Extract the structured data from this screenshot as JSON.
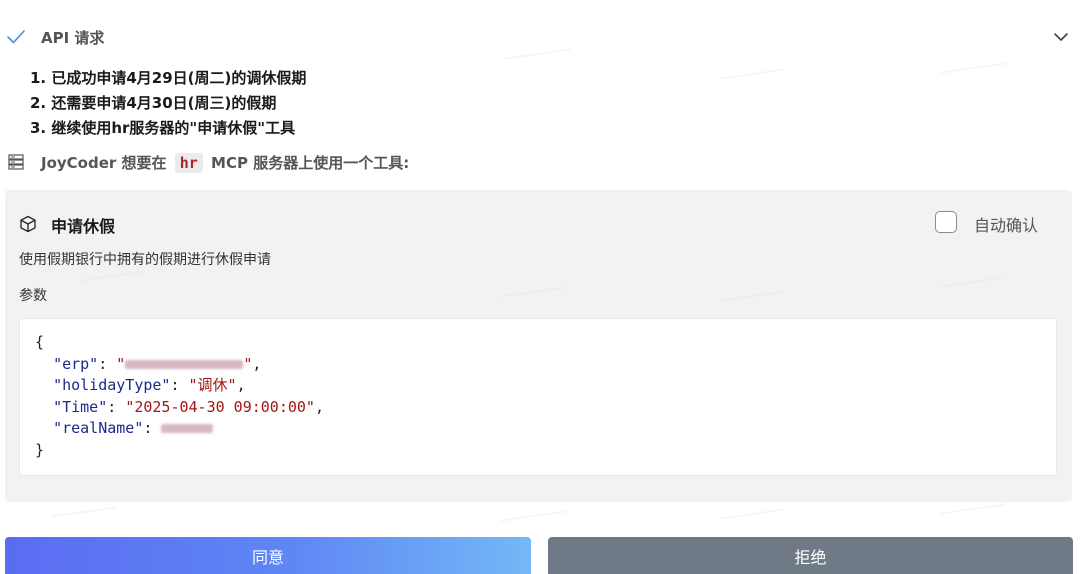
{
  "header": {
    "title": "API 请求"
  },
  "steps": [
    "1. 已成功申请4月29日(周二)的调休假期",
    "2. 还需要申请4月30日(周三)的假期",
    "3. 继续使用hr服务器的\"申请休假\"工具"
  ],
  "prompt": {
    "prefix": "JoyCoder 想要在",
    "server_tag": "hr",
    "suffix": "MCP 服务器上使用一个工具:"
  },
  "tool": {
    "name": "申请休假",
    "auto_confirm_label": "自动确认",
    "auto_confirm_checked": false,
    "description": "使用假期银行中拥有的假期进行休假申请",
    "params_label": "参数"
  },
  "code": {
    "open": "{",
    "close": "}",
    "keys": [
      "\"erp\"",
      "\"holidayType\"",
      "\"Time\"",
      "\"realName\""
    ],
    "values": {
      "holidayType": "\"调休\"",
      "Time": "\"2025-04-30 09:00:00\""
    }
  },
  "buttons": {
    "agree": "同意",
    "reject": "拒绝"
  },
  "colors": {
    "agree_start": "#5a6cf2",
    "agree_end": "#73b8f6",
    "reject": "#707a87",
    "panel_bg": "#f2f2f2",
    "json_key": "#1c2a8c",
    "json_string": "#a31515"
  }
}
